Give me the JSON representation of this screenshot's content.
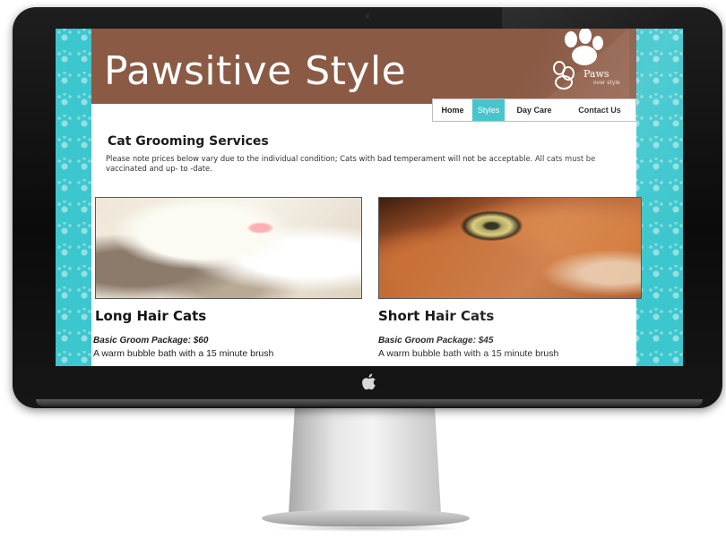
{
  "site": {
    "title": "Pawsitive Style",
    "logo_word": "Paws",
    "logo_tagline": "over style",
    "colors": {
      "header": "#8a5a45",
      "accent": "#48c5cc",
      "background_pattern": "#3cc6cd"
    }
  },
  "nav": {
    "items": [
      {
        "label": "Home"
      },
      {
        "label": "Styles"
      },
      {
        "label": "Day Care"
      },
      {
        "label": "Contact Us"
      }
    ],
    "active": "Styles"
  },
  "main": {
    "heading": "Cat Grooming Services",
    "notice": "Please note prices below vary due to the individual condition; Cats with bad temperament will not be acceptable. All cats must be vaccinated and up- to -date.",
    "columns": [
      {
        "title": "Long Hair Cats",
        "photo": "long-hair-cat-photo",
        "package": "Basic Groom Package: $60",
        "description": "A warm bubble bath with a 15 minute brush"
      },
      {
        "title": "Short Hair Cats",
        "photo": "short-hair-cat-photo",
        "package": "Basic Groom Package: $45",
        "description": "A warm bubble bath with a 15 minute brush"
      }
    ]
  },
  "device": {
    "icons": [
      "apple-logo-icon",
      "camera-icon"
    ]
  }
}
